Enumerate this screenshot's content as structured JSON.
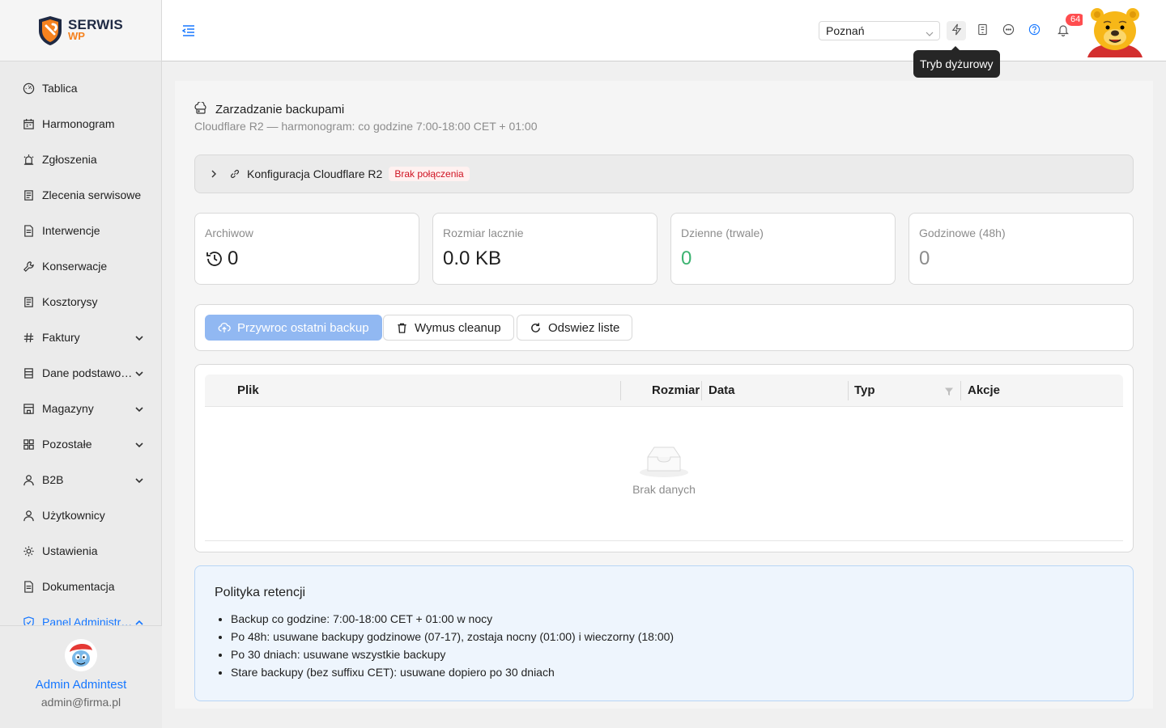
{
  "logo": {
    "line1": "SERWIS",
    "line2": "WP"
  },
  "nav": [
    {
      "label": "Tablica",
      "icon": "dashboard-icon",
      "expand": false
    },
    {
      "label": "Harmonogram",
      "icon": "calendar-icon",
      "expand": false
    },
    {
      "label": "Zgłoszenia",
      "icon": "alarm-icon",
      "expand": false
    },
    {
      "label": "Zlecenia serwisowe",
      "icon": "clipboard-icon",
      "expand": false
    },
    {
      "label": "Interwencje",
      "icon": "file-icon",
      "expand": false
    },
    {
      "label": "Konserwacje",
      "icon": "wrench-icon",
      "expand": false
    },
    {
      "label": "Kosztorysy",
      "icon": "clipboard-icon",
      "expand": false
    },
    {
      "label": "Faktury",
      "icon": "hash-icon",
      "expand": true
    },
    {
      "label": "Dane podstawowe",
      "icon": "database-icon",
      "expand": true
    },
    {
      "label": "Magazyny",
      "icon": "warehouse-icon",
      "expand": true
    },
    {
      "label": "Pozostałe",
      "icon": "grid-icon",
      "expand": true
    },
    {
      "label": "B2B",
      "icon": "user-icon",
      "expand": true
    },
    {
      "label": "Użytkownicy",
      "icon": "user-icon",
      "expand": false
    },
    {
      "label": "Ustawienia",
      "icon": "gear-icon",
      "expand": false
    },
    {
      "label": "Dokumentacja",
      "icon": "file-icon",
      "expand": false
    },
    {
      "label": "Panel Administratora",
      "icon": "shield-icon",
      "expand": true,
      "active": true
    }
  ],
  "user": {
    "name": "Admin Admintest",
    "email": "admin@firma.pl"
  },
  "header": {
    "city": "Poznań",
    "notifications_count": "64",
    "tooltip": "Tryb dyżurowy"
  },
  "page": {
    "title": "Zarzadzanie backupami",
    "subtitle": "Cloudflare R2 — harmonogram: co godzine 7:00-18:00 CET + 01:00"
  },
  "config": {
    "label": "Konfiguracja Cloudflare R2",
    "status": "Brak połączenia"
  },
  "stats": [
    {
      "label": "Archiwow",
      "value": "0"
    },
    {
      "label": "Rozmiar lacznie",
      "value": "0.0 KB"
    },
    {
      "label": "Dzienne (trwale)",
      "value": "0"
    },
    {
      "label": "Godzinowe (48h)",
      "value": "0"
    }
  ],
  "toolbar": {
    "restore": "Przywroc ostatni backup",
    "cleanup": "Wymus cleanup",
    "refresh": "Odswiez liste"
  },
  "table": {
    "columns": [
      "Plik",
      "Rozmiar",
      "Data",
      "Typ",
      "Akcje"
    ],
    "empty_text": "Brak danych"
  },
  "policy": {
    "heading": "Polityka retencji",
    "items": [
      "Backup co godzine: 7:00-18:00 CET + 01:00 w nocy",
      "Po 48h: usuwane backupy godzinowe (07-17), zostaja nocny (01:00) i wieczorny (18:00)",
      "Po 30 dniach: usuwane wszystkie backupy",
      "Stare backupy (bez suffixu CET): usuwane dopiero po 30 dniach"
    ]
  },
  "colors": {
    "accent": "#1677ff",
    "brand_orange": "#f5821f",
    "success": "#3cb371",
    "danger": "#cf1322"
  }
}
